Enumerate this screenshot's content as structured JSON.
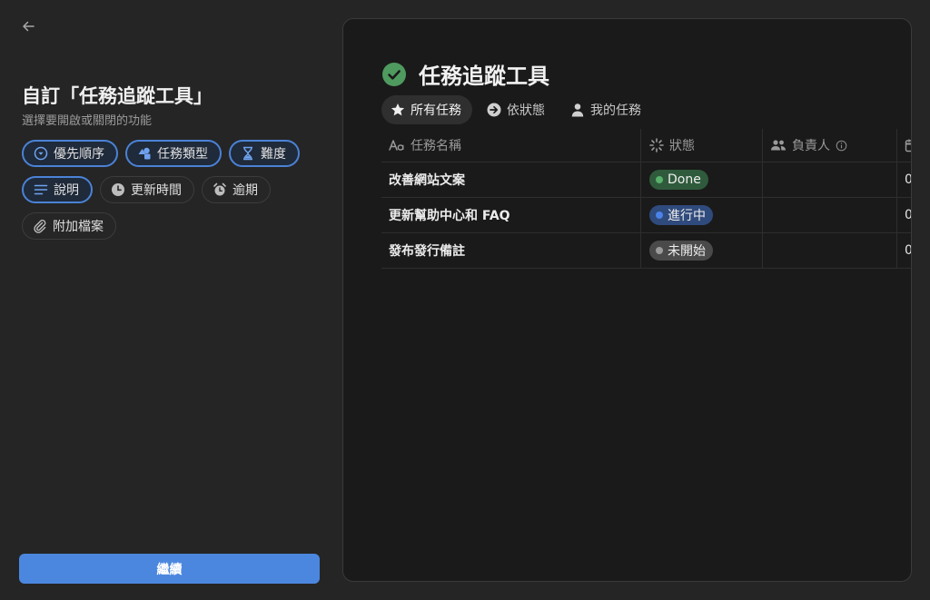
{
  "setup": {
    "title": "自訂「任務追蹤工具」",
    "subtitle": "選擇要開啟或關閉的功能",
    "continue_label": "繼續",
    "features": [
      {
        "label": "優先順序",
        "icon": "priority-icon",
        "enabled": true
      },
      {
        "label": "任務類型",
        "icon": "shapes-icon",
        "enabled": true
      },
      {
        "label": "難度",
        "icon": "hourglass-icon",
        "enabled": true
      },
      {
        "label": "說明",
        "icon": "text-lines-icon",
        "enabled": true
      },
      {
        "label": "更新時間",
        "icon": "clock-icon",
        "enabled": false
      },
      {
        "label": "逾期",
        "icon": "alarm-icon",
        "enabled": false
      },
      {
        "label": "附加檔案",
        "icon": "paperclip-icon",
        "enabled": false
      }
    ]
  },
  "preview": {
    "title": "任務追蹤工具",
    "tabs": [
      {
        "label": "所有任務",
        "icon": "star-icon",
        "active": true
      },
      {
        "label": "依狀態",
        "icon": "arrow-circle-icon",
        "active": false
      },
      {
        "label": "我的任務",
        "icon": "person-icon",
        "active": false
      }
    ],
    "columns": {
      "name": "任務名稱",
      "status": "狀態",
      "assignee": "負責人"
    },
    "rows": [
      {
        "name": "改善網站文案",
        "status": "Done",
        "due": "0"
      },
      {
        "name": "更新幫助中心和 FAQ",
        "status": "進行中",
        "due": "0"
      },
      {
        "name": "發布發行備註",
        "status": "未開始",
        "due": "0"
      }
    ]
  },
  "colors": {
    "accent": "#4b87de",
    "done_bg": "#2f5b3c",
    "done_dot": "#58b06a",
    "progress_bg": "#2f4a7c",
    "progress_dot": "#4b82e8",
    "notstarted_bg": "#4a4a4a",
    "notstarted_dot": "#9a9a9a"
  }
}
